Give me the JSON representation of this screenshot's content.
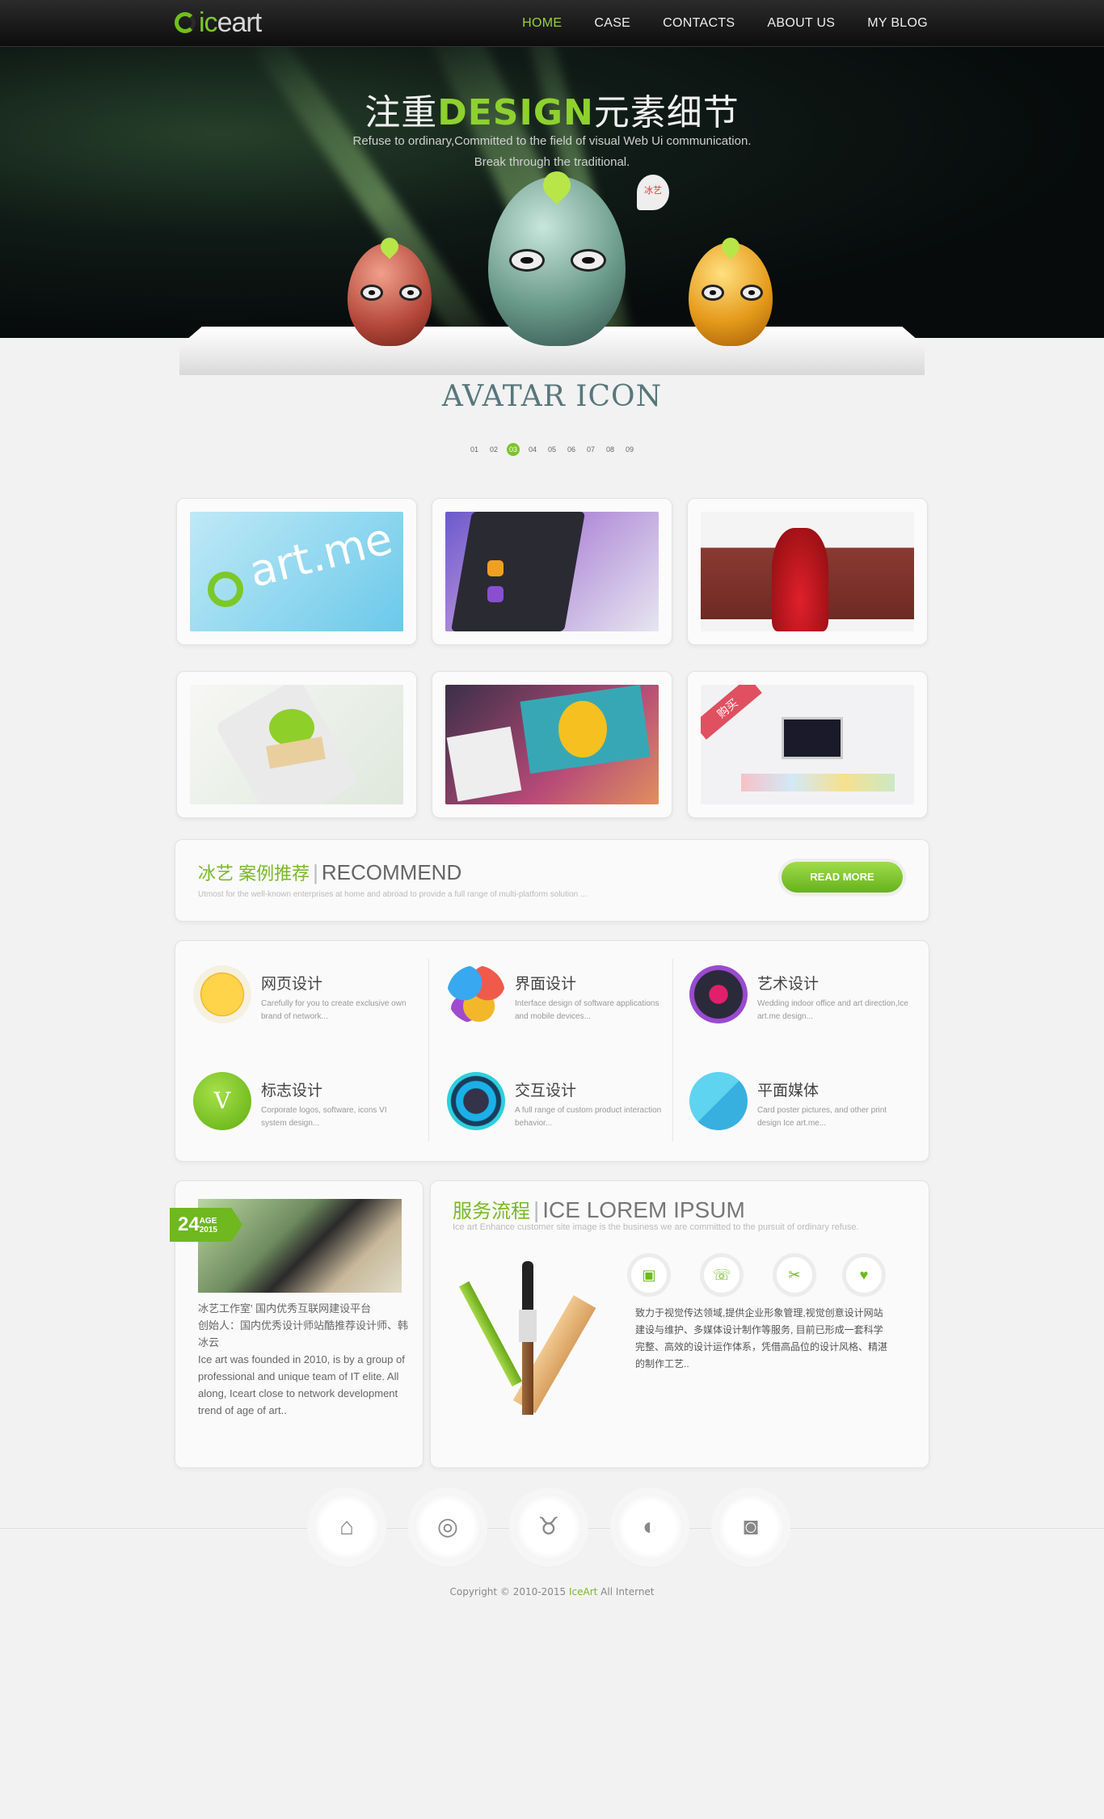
{
  "header": {
    "logo_text_pre": "ic",
    "logo_text_post": "eart",
    "nav": [
      {
        "label": "HOME",
        "active": true
      },
      {
        "label": "CASE"
      },
      {
        "label": "CONTACTS"
      },
      {
        "label": "ABOUT US"
      },
      {
        "label": "MY BLOG"
      }
    ]
  },
  "hero": {
    "title_pre": "注重",
    "title_accent": "DESIGN",
    "title_post": "元素细节",
    "subtitle_line1": "Refuse to ordinary,Committed to the field of visual Web Ui communication.",
    "subtitle_line2": "Break through the traditional.",
    "bubble_text": "冰艺"
  },
  "avatar_section": {
    "title": "AVATAR ICON",
    "pages": [
      "01",
      "02",
      "03",
      "04",
      "05",
      "06",
      "07",
      "08",
      "09"
    ],
    "active_page": "03"
  },
  "recommend": {
    "title_cn": "冰艺 案例推荐",
    "title_en": "RECOMMEND",
    "subtitle": "Utmost for the well-known enterprises at home and abroad to provide a full range of multi-platform solution ...",
    "button": "READ MORE"
  },
  "services": [
    {
      "title": "网页设计",
      "desc": "Carefully for you to create exclusive own brand of network..."
    },
    {
      "title": "界面设计",
      "desc": "Interface design of software applications and mobile devices..."
    },
    {
      "title": "艺术设计",
      "desc": "Wedding indoor office and art direction,Ice art.me design..."
    },
    {
      "title": "标志设计",
      "desc": "Corporate logos, software, icons VI system design..."
    },
    {
      "title": "交互设计",
      "desc": "A full range of custom product interaction behavior..."
    },
    {
      "title": "平面媒体",
      "desc": "Card poster pictures, and other print design Ice art.me..."
    }
  ],
  "about": {
    "age": "24",
    "age_label": "AGE",
    "age_year": "2015",
    "line1": "冰艺工作室' 国内优秀互联网建设平台",
    "line2": "创始人：国内优秀设计师站酷推荐设计师、韩冰云",
    "body": "Ice art was founded in 2010, is by a group of professional and unique team of IT elite. All along, Iceart close to network development trend of age of art.."
  },
  "process": {
    "title_cn": "服务流程",
    "title_en": "ICE LOREM IPSUM",
    "subtitle": "Ice art Enhance customer site image is the business we are committed to the pursuit of ordinary refuse.",
    "text": "致力于视觉传达领域,提供企业形象管理,视觉创意设计网站建设与维护、多媒体设计制作等服务, 目前已形成一套科学完整、高效的设计运作体系，凭借高品位的设计风格、精湛的制作工艺.."
  },
  "footer": {
    "social_icons": [
      "home-icon",
      "weibo-icon",
      "cow-icon",
      "blog-icon",
      "camera-icon"
    ],
    "copyright_pre": "Copyright © 2010-2015 ",
    "copyright_brand": "IceArt",
    "copyright_post": " All Internet"
  },
  "colors": {
    "accent": "#7ab828",
    "dark": "#111111"
  }
}
